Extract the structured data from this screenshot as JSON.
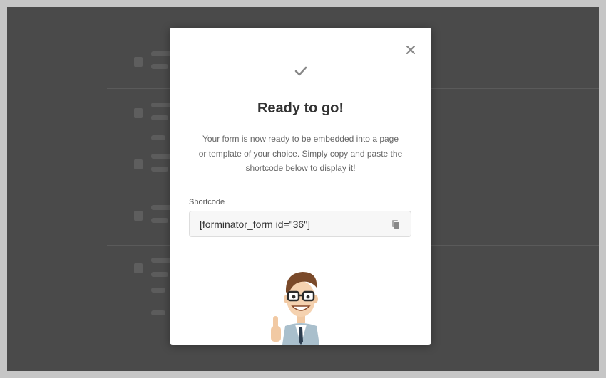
{
  "modal": {
    "title": "Ready to go!",
    "description": "Your form is now ready to be embedded into a page or template of your choice. Simply copy and paste the shortcode below to display it!",
    "shortcode_label": "Shortcode",
    "shortcode_value": "[forminator_form id=\"36\"]",
    "icons": {
      "close": "close-icon",
      "success": "check-icon",
      "copy": "copy-icon"
    }
  },
  "colors": {
    "overlay": "#4a4a4a",
    "outer_frame": "#c6c6c6",
    "modal_bg": "#ffffff",
    "title": "#333333",
    "text": "#666666",
    "icon": "#888888"
  }
}
